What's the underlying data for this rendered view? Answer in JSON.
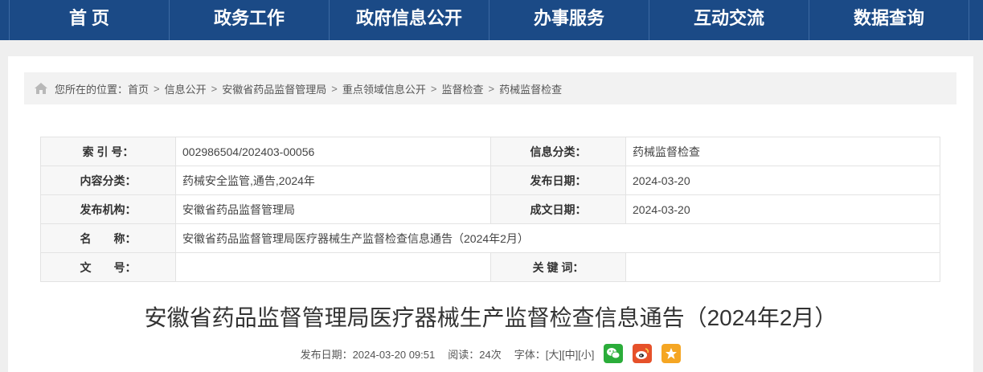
{
  "nav": [
    "首 页",
    "政务工作",
    "政府信息公开",
    "办事服务",
    "互动交流",
    "数据查询"
  ],
  "breadcrumb": {
    "prefix": "您所在的位置：",
    "items": [
      "首页",
      "信息公开",
      "安徽省药品监督管理局",
      "重点领域信息公开",
      "监督检查",
      "药械监督检查"
    ]
  },
  "meta": {
    "index_label": "索 引 号：",
    "index_value": "002986504/202403-00056",
    "category_label": "信息分类：",
    "category_value": "药械监督检查",
    "content_label": "内容分类：",
    "content_value": "药械安全监管,通告,2024年",
    "pubdate_label": "发布日期：",
    "pubdate_value": "2024-03-20",
    "org_label": "发布机构：",
    "org_value": "安徽省药品监督管理局",
    "docdate_label": "成文日期：",
    "docdate_value": "2024-03-20",
    "name_label": "名　　称：",
    "name_value": "安徽省药品监督管理局医疗器械生产监督检查信息通告（2024年2月）",
    "docno_label": "文　　号：",
    "docno_value": "",
    "keywords_label": "关 键 词：",
    "keywords_value": ""
  },
  "article": {
    "title": "安徽省药品监督管理局医疗器械生产监督检查信息通告（2024年2月）",
    "publish": "发布日期：2024-03-20 09:51",
    "reads": "阅读：24次",
    "font_label": "字体：",
    "font_large": "[大]",
    "font_medium": "[中]",
    "font_small": "[小]"
  },
  "share_icons": [
    "wechat-icon",
    "weibo-icon",
    "favorite-icon"
  ],
  "colors": {
    "nav_bg": "#1b4a86",
    "wechat": "#2bad3a",
    "weibo": "#e6512a",
    "favorite": "#f5a623"
  }
}
